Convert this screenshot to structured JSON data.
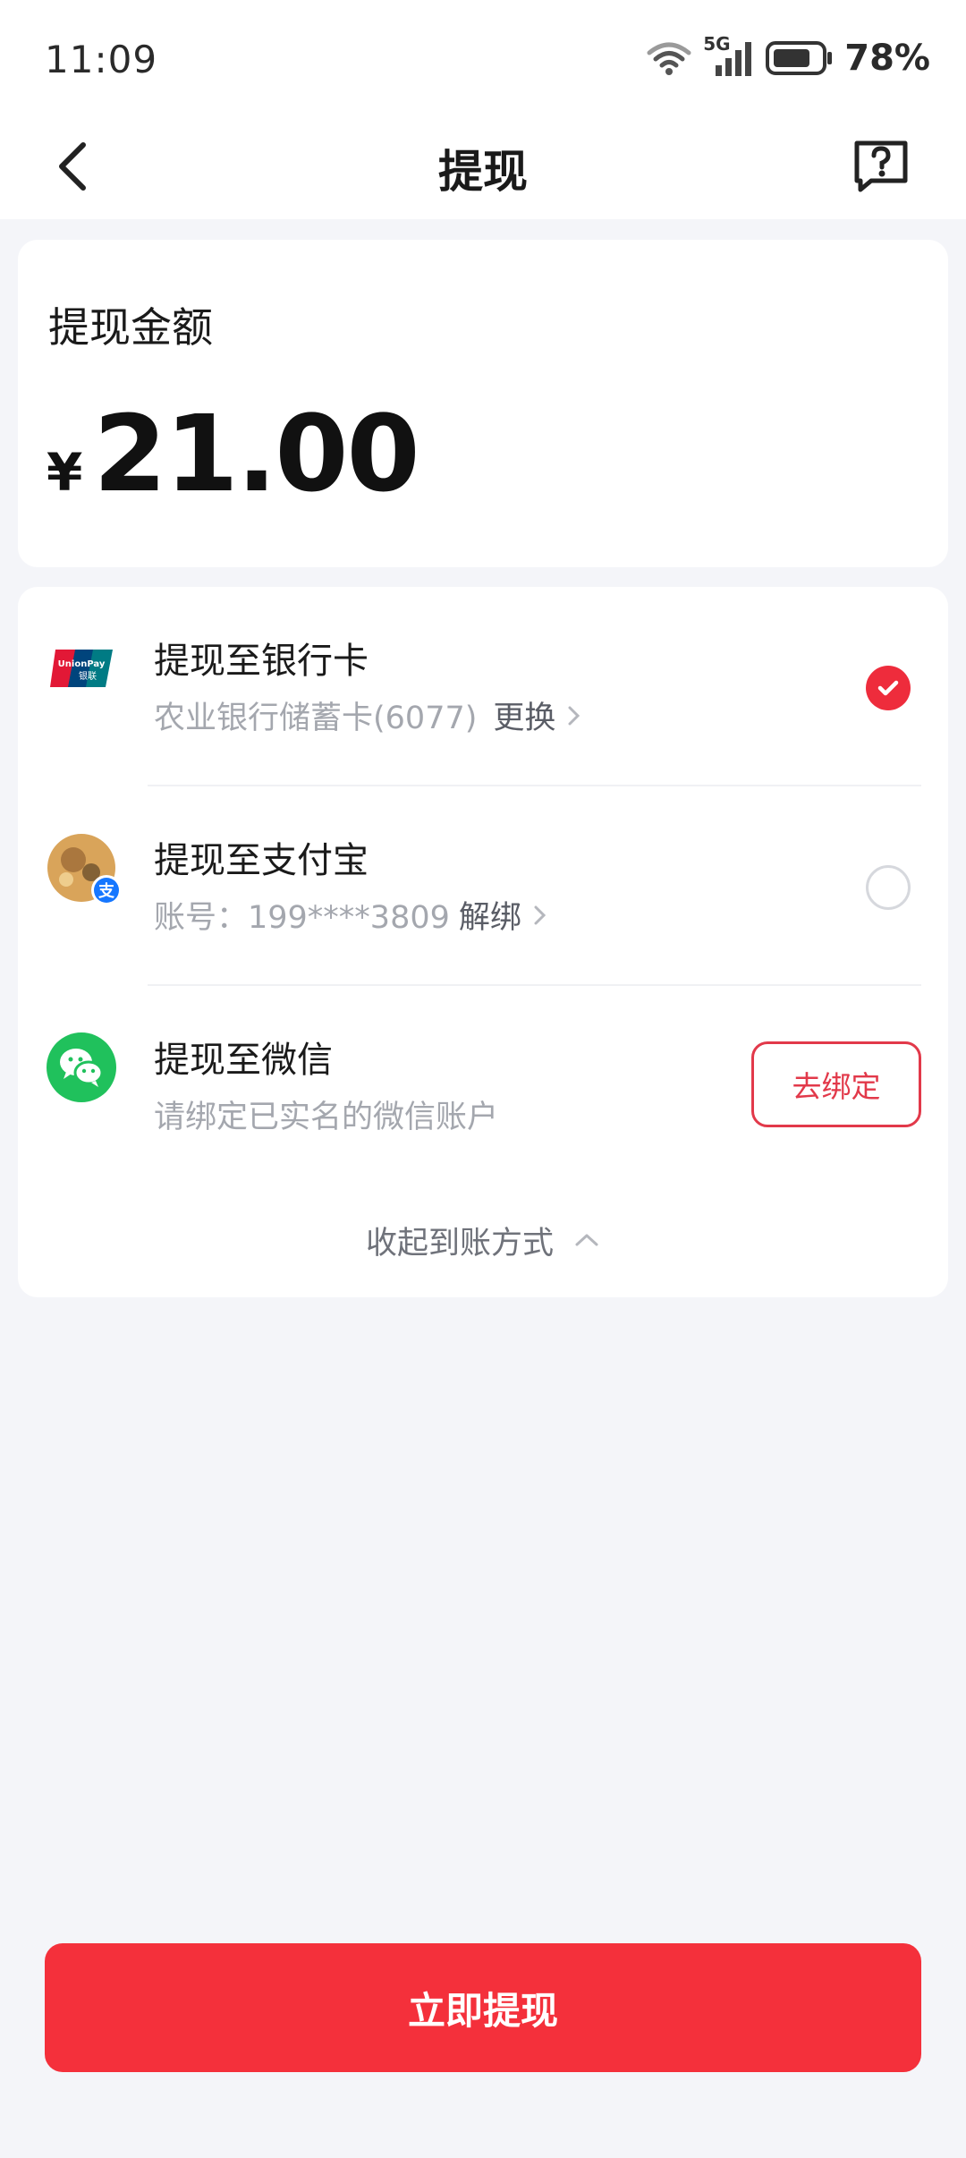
{
  "status_bar": {
    "time": "11:09",
    "network": "5G",
    "battery": "78%"
  },
  "nav": {
    "title": "提现",
    "back_icon": "chevron-left-icon",
    "help_icon": "question-message-icon"
  },
  "amount_card": {
    "label": "提现金额",
    "currency": "¥",
    "amount": "21.00"
  },
  "methods": {
    "items": [
      {
        "title": "提现至银行卡",
        "subtitle": "农业银行储蓄卡(6077)",
        "action": "更换",
        "icon": "unionpay-icon",
        "state": "selected"
      },
      {
        "title": "提现至支付宝",
        "subtitle": "账号：199****3809",
        "action": "解绑",
        "icon": "alipay-avatar-icon",
        "state": "unselected"
      },
      {
        "title": "提现至微信",
        "subtitle": "请绑定已实名的微信账户",
        "button": "去绑定",
        "icon": "wechat-icon",
        "state": "unbound"
      }
    ],
    "collapse_label": "收起到账方式"
  },
  "submit": {
    "label": "立即提现"
  },
  "colors": {
    "accent": "#f4303b",
    "background": "#f4f5f9",
    "muted_text": "#a4a7ae"
  }
}
